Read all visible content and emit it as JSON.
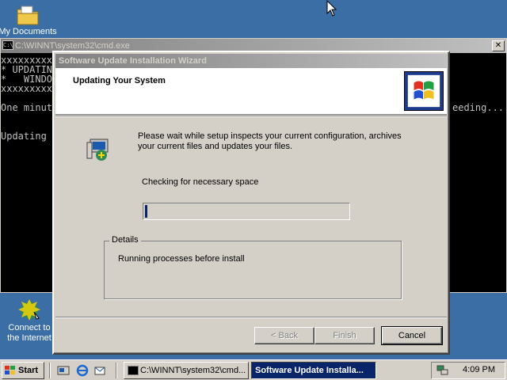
{
  "desktop": {
    "icons": [
      {
        "label": "My Documents"
      },
      {
        "label_line1": "Connect to",
        "label_line2": "the Internet"
      }
    ]
  },
  "cmd_window": {
    "title": "C:\\WINNT\\system32\\cmd.exe",
    "close_glyph": "✕",
    "lines": [
      "xxxxxxxxx",
      "* UPDATIN",
      "*   WINDO",
      "xxxxxxxxx",
      "One minut",
      "Updating"
    ],
    "right_fragment": "eeding..."
  },
  "wizard": {
    "title": "Software Update Installation Wizard",
    "header_title": "Updating Your System",
    "description": "Please wait while setup inspects your current configuration, archives your current files and updates your files.",
    "status": "Checking for necessary space",
    "progress": 0.01,
    "details_legend": "Details",
    "details_text": "Running processes before install",
    "buttons": {
      "back": "< Back",
      "finish": "Finish",
      "cancel": "Cancel"
    }
  },
  "taskbar": {
    "start_label": "Start",
    "tasks": [
      {
        "label": "C:\\WINNT\\system32\\cmd..."
      },
      {
        "label": "Software Update Installa..."
      }
    ],
    "clock": "4:09 PM"
  },
  "colors": {
    "desktop": "#3a6ea5",
    "title_inactive": "#808080",
    "active_task": "#0a246a"
  }
}
